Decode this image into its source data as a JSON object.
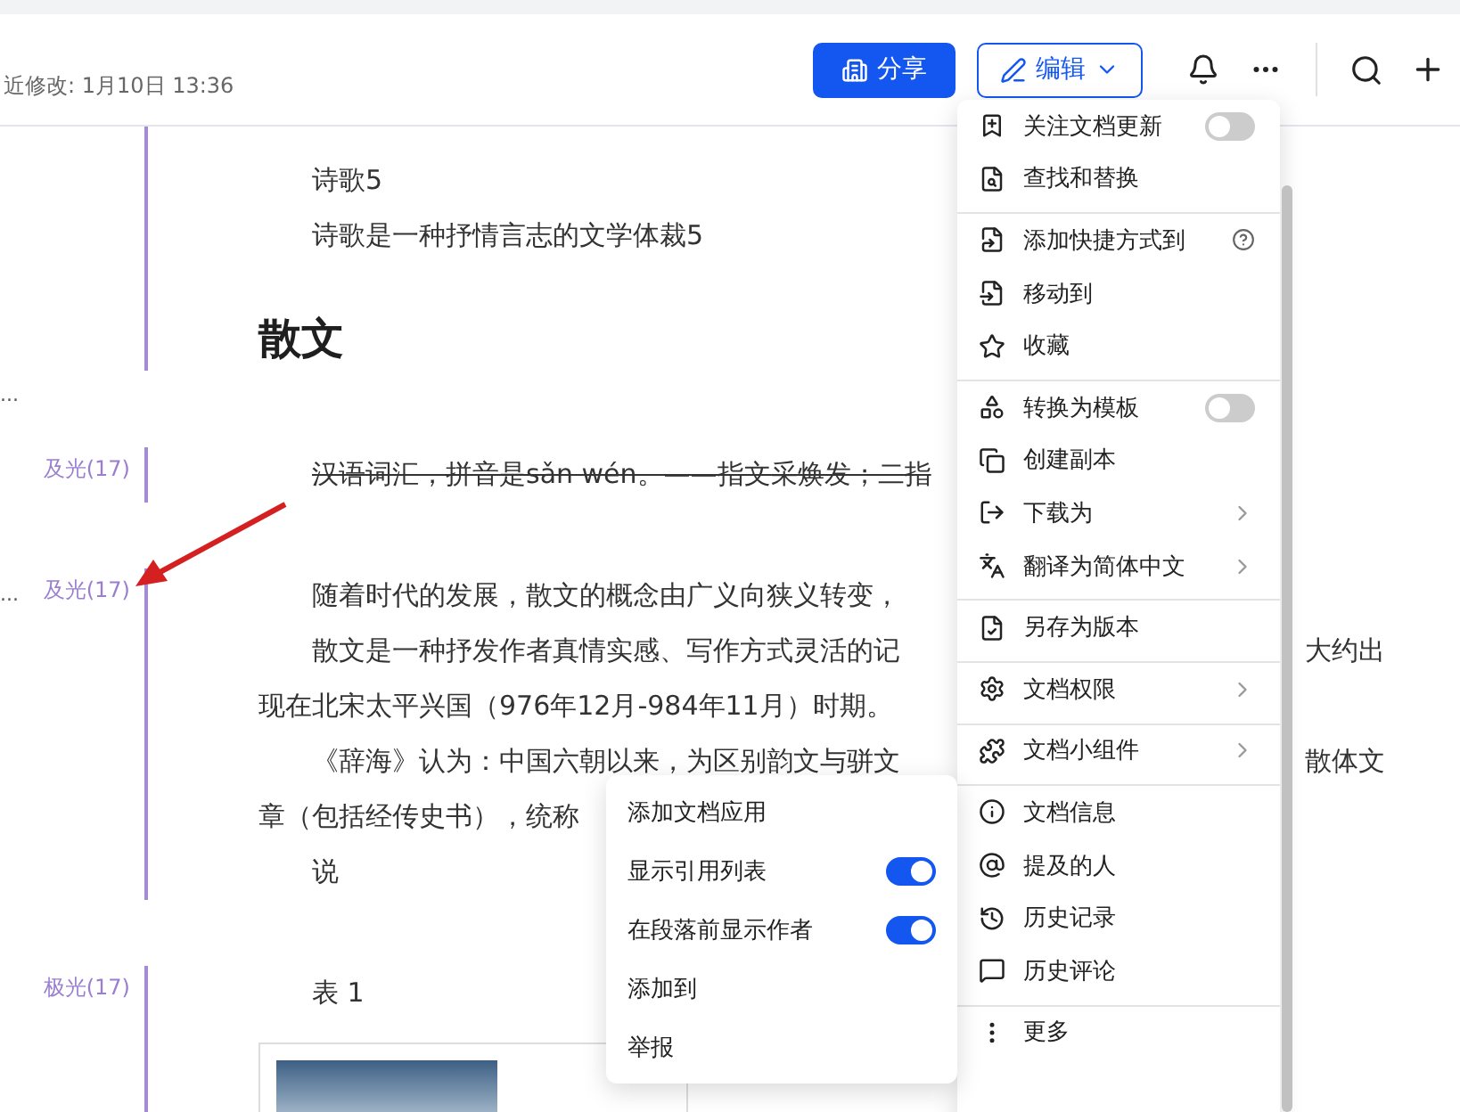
{
  "header": {
    "modified": "近修改: 1月10日 13:36",
    "share_button": "分享",
    "edit_button": "编辑"
  },
  "document": [
    {
      "kind": "section",
      "attributed": true,
      "paragraphs": [
        {
          "kind": "p",
          "text": "诗歌5"
        },
        {
          "kind": "p",
          "text": "诗歌是一种抒情言志的文学体裁5"
        },
        {
          "kind": "h",
          "text": "散文"
        }
      ]
    },
    {
      "kind": "gap",
      "side_note": "...",
      "attributed": false
    },
    {
      "kind": "section",
      "author": "及光(17)",
      "attributed": true,
      "paragraphs": [
        {
          "kind": "strike",
          "text": "汉语词汇，拼音是sǎn wén。——指文采焕发；二指"
        }
      ]
    },
    {
      "kind": "gap",
      "attributed": false
    },
    {
      "kind": "section",
      "author": "及光(17)",
      "side_note": "...",
      "attributed": true,
      "paragraphs": [
        {
          "kind": "p",
          "text": "随着时代的发展，散文的概念由广义向狭义转变，"
        },
        {
          "kind": "p",
          "text": "散文是一种抒发作者真情实感、写作方式灵活的记",
          "right": "大约出"
        },
        {
          "kind": "cont",
          "text": "现在北宋太平兴国（976年12月-984年11月）时期。"
        },
        {
          "kind": "p",
          "text": "《辞海》认为：中国六朝以来，为区别韵文与骈文",
          "right": "散体文"
        },
        {
          "kind": "cont",
          "text": "章（包括经传史书），统称"
        },
        {
          "kind": "p",
          "text": "说"
        }
      ]
    },
    {
      "kind": "gap",
      "attributed": false
    },
    {
      "kind": "section",
      "author": "极光(17)",
      "attributed": true,
      "paragraphs": [
        {
          "kind": "p",
          "text": "表 1"
        },
        {
          "kind": "table"
        }
      ]
    }
  ],
  "menu": [
    {
      "label": "关注文档更新",
      "kind": "toggle",
      "on": false,
      "separated": false
    },
    {
      "label": "查找和替换",
      "kind": "plain",
      "separated": false
    },
    {
      "label": "添加快捷方式到",
      "kind": "help",
      "separated": true
    },
    {
      "label": "移动到",
      "kind": "plain",
      "separated": false
    },
    {
      "label": "收藏",
      "kind": "plain",
      "separated": false
    },
    {
      "label": "转换为模板",
      "kind": "toggle",
      "on": false,
      "separated": true
    },
    {
      "label": "创建副本",
      "kind": "plain",
      "separated": false
    },
    {
      "label": "下载为",
      "kind": "submenu",
      "separated": false
    },
    {
      "label": "翻译为简体中文",
      "kind": "submenu",
      "separated": false
    },
    {
      "label": "另存为版本",
      "kind": "plain",
      "separated": true
    },
    {
      "label": "文档权限",
      "kind": "submenu",
      "separated": true
    },
    {
      "label": "文档小组件",
      "kind": "submenu",
      "separated": true
    },
    {
      "label": "文档信息",
      "kind": "plain",
      "separated": true
    },
    {
      "label": "提及的人",
      "kind": "plain",
      "separated": false
    },
    {
      "label": "历史记录",
      "kind": "plain",
      "separated": false
    },
    {
      "label": "历史评论",
      "kind": "plain",
      "separated": false
    },
    {
      "label": "更多",
      "kind": "plain",
      "separated": true
    }
  ],
  "submenu": [
    {
      "label": "添加文档应用",
      "kind": "plain"
    },
    {
      "label": "显示引用列表",
      "kind": "toggle",
      "on": true
    },
    {
      "label": "在段落前显示作者",
      "kind": "toggle",
      "on": true
    },
    {
      "label": "添加到",
      "kind": "plain"
    },
    {
      "label": "举报",
      "kind": "plain"
    }
  ]
}
